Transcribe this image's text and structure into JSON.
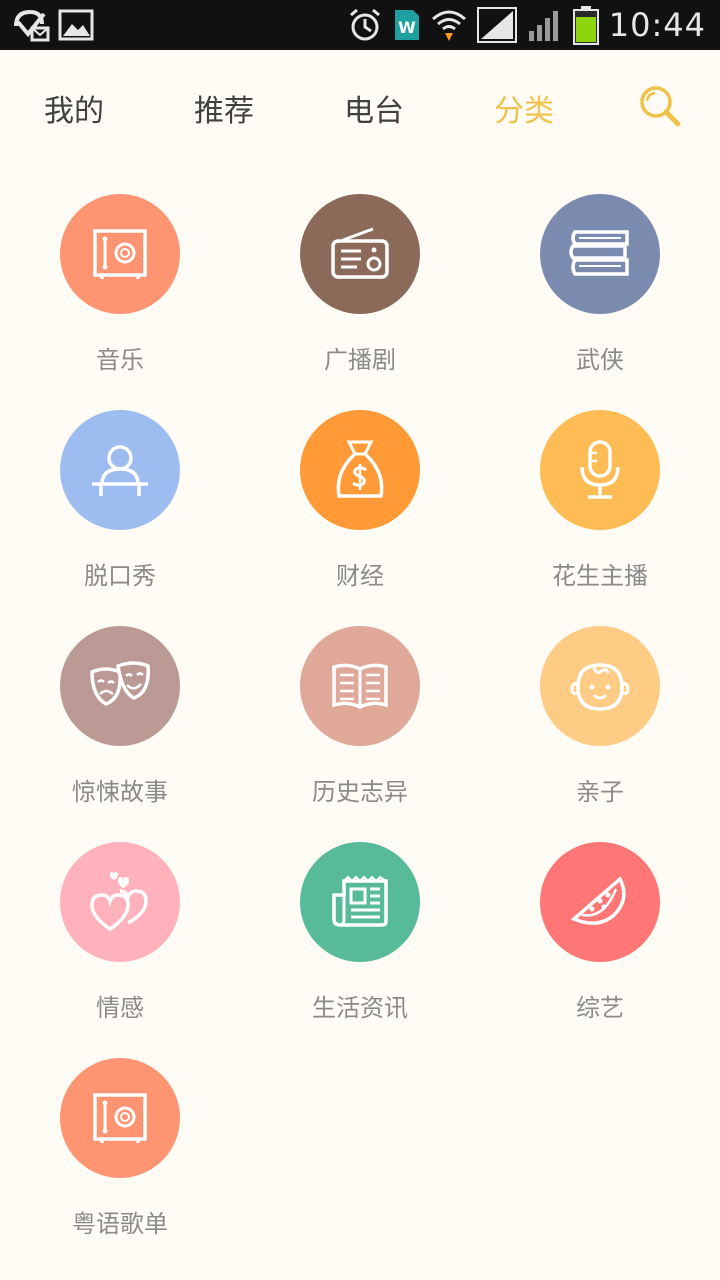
{
  "status_bar": {
    "time": "10:44",
    "icons": [
      "notification-icon",
      "gallery-icon",
      "alarm-icon",
      "wps-icon",
      "wifi-icon",
      "signal-icon",
      "signal-icon-2",
      "battery-icon"
    ],
    "wps_letter": "W"
  },
  "tabs": [
    {
      "label": "我的",
      "active": false
    },
    {
      "label": "推荐",
      "active": false
    },
    {
      "label": "电台",
      "active": false
    },
    {
      "label": "分类",
      "active": true
    }
  ],
  "colors": {
    "accent": "#f0c24a",
    "background": "#fffcf5",
    "label": "#8a8a8a"
  },
  "categories": [
    {
      "label": "音乐",
      "icon": "safe-icon",
      "color": "#ff9472"
    },
    {
      "label": "广播剧",
      "icon": "radio-icon",
      "color": "#8c6a5a"
    },
    {
      "label": "武侠",
      "icon": "books-icon",
      "color": "#7b8bb0"
    },
    {
      "label": "脱口秀",
      "icon": "person-podium-icon",
      "color": "#9dbdf0"
    },
    {
      "label": "财经",
      "icon": "money-bag-icon",
      "color": "#ff9a36"
    },
    {
      "label": "花生主播",
      "icon": "microphone-icon",
      "color": "#ffbc54"
    },
    {
      "label": "惊悚故事",
      "icon": "theater-masks-icon",
      "color": "#bb9a96"
    },
    {
      "label": "历史志异",
      "icon": "open-book-icon",
      "color": "#dfa898"
    },
    {
      "label": "亲子",
      "icon": "baby-face-icon",
      "color": "#ffcc86"
    },
    {
      "label": "情感",
      "icon": "hearts-icon",
      "color": "#ffb2bc"
    },
    {
      "label": "生活资讯",
      "icon": "newspaper-icon",
      "color": "#57bb9a"
    },
    {
      "label": "综艺",
      "icon": "watermelon-icon",
      "color": "#ff7676"
    },
    {
      "label": "粤语歌单",
      "icon": "safe-icon",
      "color": "#ff9472"
    }
  ]
}
